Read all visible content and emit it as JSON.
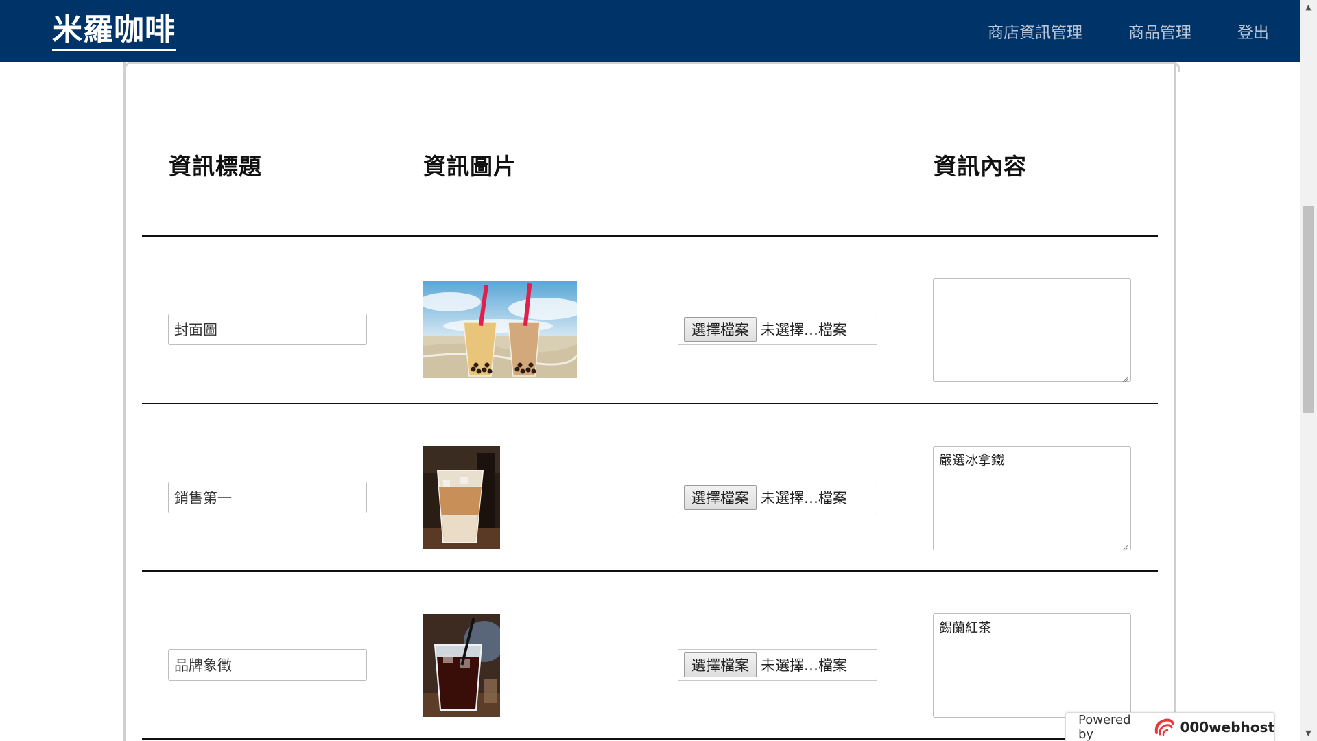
{
  "navbar": {
    "brand": "米羅咖啡",
    "links": [
      "商店資訊管理",
      "商品管理",
      "登出"
    ]
  },
  "table": {
    "headers": {
      "title": "資訊標題",
      "image": "資訊圖片",
      "content": "資訊內容"
    },
    "rows": [
      {
        "title": "封面圖",
        "image_icon": "bubble-tea-on-beach-photo",
        "file_button": "選擇檔案",
        "file_status": "未選擇…檔案",
        "content": ""
      },
      {
        "title": "銷售第一",
        "image_icon": "iced-latte-photo",
        "file_button": "選擇檔案",
        "file_status": "未選擇…檔案",
        "content": "嚴選冰拿鐵"
      },
      {
        "title": "品牌象徵",
        "image_icon": "iced-black-tea-photo",
        "file_button": "選擇檔案",
        "file_status": "未選擇…檔案",
        "content": "錫蘭紅茶"
      }
    ]
  },
  "footer_badge": {
    "prefix": "Powered by",
    "name": "000webhost"
  },
  "colors": {
    "navbar_bg": "#003468",
    "nav_link": "#b9c5d6",
    "badge_accent": "#e8383d"
  }
}
